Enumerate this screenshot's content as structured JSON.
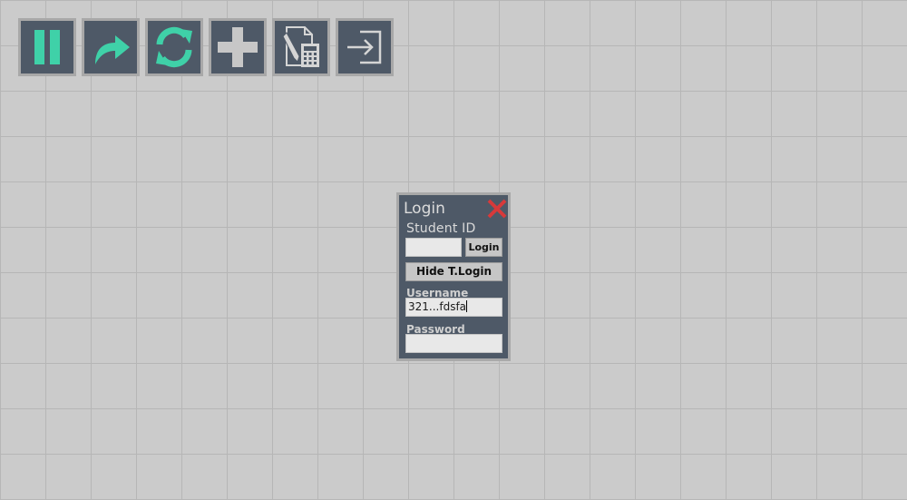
{
  "toolbar": {
    "buttons": [
      {
        "name": "pause",
        "icon": "pause-icon"
      },
      {
        "name": "redo",
        "icon": "redo-arrow-icon"
      },
      {
        "name": "refresh",
        "icon": "refresh-icon"
      },
      {
        "name": "add",
        "icon": "plus-icon"
      },
      {
        "name": "calculator-document",
        "icon": "document-calculator-icon"
      },
      {
        "name": "exit",
        "icon": "exit-icon"
      }
    ]
  },
  "login_dialog": {
    "title": "Login",
    "student_id_label": "Student ID",
    "student_id_value": "",
    "login_button": "Login",
    "hide_button": "Hide T.Login",
    "username_label": "Username",
    "username_value": "321...fdsfa",
    "password_label": "Password",
    "password_value": ""
  },
  "colors": {
    "background": "#cbcbcb",
    "grid_line": "#b6b6b6",
    "panel": "#4e5967",
    "accent": "#3fd1a8",
    "close_red": "#d8393a"
  }
}
